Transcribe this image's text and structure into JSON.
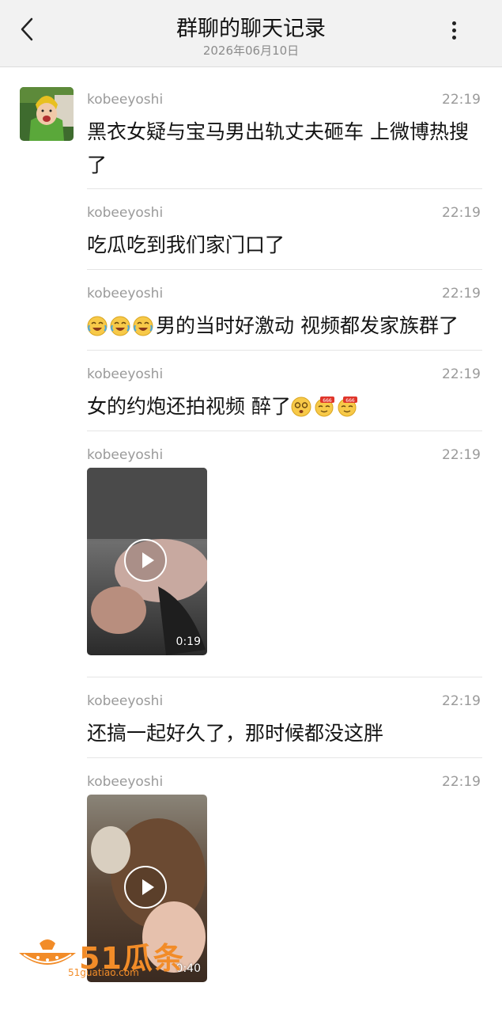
{
  "header": {
    "back_icon": "chevron-left-icon",
    "title": "群聊的聊天记录",
    "date": "2026年06月10日",
    "more_icon": "vertical-ellipsis-icon"
  },
  "messages": [
    {
      "sender": "kobeeyoshi",
      "time": "22:19",
      "text": "黑衣女疑与宝马男出轨丈夫砸车 上微博热搜了"
    },
    {
      "sender": "kobeeyoshi",
      "time": "22:19",
      "text": "吃瓜吃到我们家门口了"
    },
    {
      "sender": "kobeeyoshi",
      "time": "22:19",
      "text": "男的当时好激动 视频都发家族群了",
      "emojis": [
        "laughing-crying-emoji",
        "laughing-crying-emoji",
        "laughing-crying-emoji"
      ]
    },
    {
      "sender": "kobeeyoshi",
      "time": "22:19",
      "text": "女的约炮还拍视频 醉了",
      "emojis_after": [
        "dizzy-face-emoji",
        "666-emoji",
        "666-emoji"
      ]
    },
    {
      "sender": "kobeeyoshi",
      "time": "22:19",
      "video_duration": "0:19"
    },
    {
      "sender": "kobeeyoshi",
      "time": "22:19",
      "text": "还搞一起好久了，那时候都没这胖"
    },
    {
      "sender": "kobeeyoshi",
      "time": "22:19",
      "video_duration": "0:40"
    }
  ],
  "watermark": {
    "text": "51瓜条",
    "subtext": "51guatiao.com"
  },
  "colors": {
    "header_bg": "#f2f2f2",
    "meta_text": "#9a9a9a",
    "body_text": "#141414",
    "watermark": "#f28c28"
  }
}
